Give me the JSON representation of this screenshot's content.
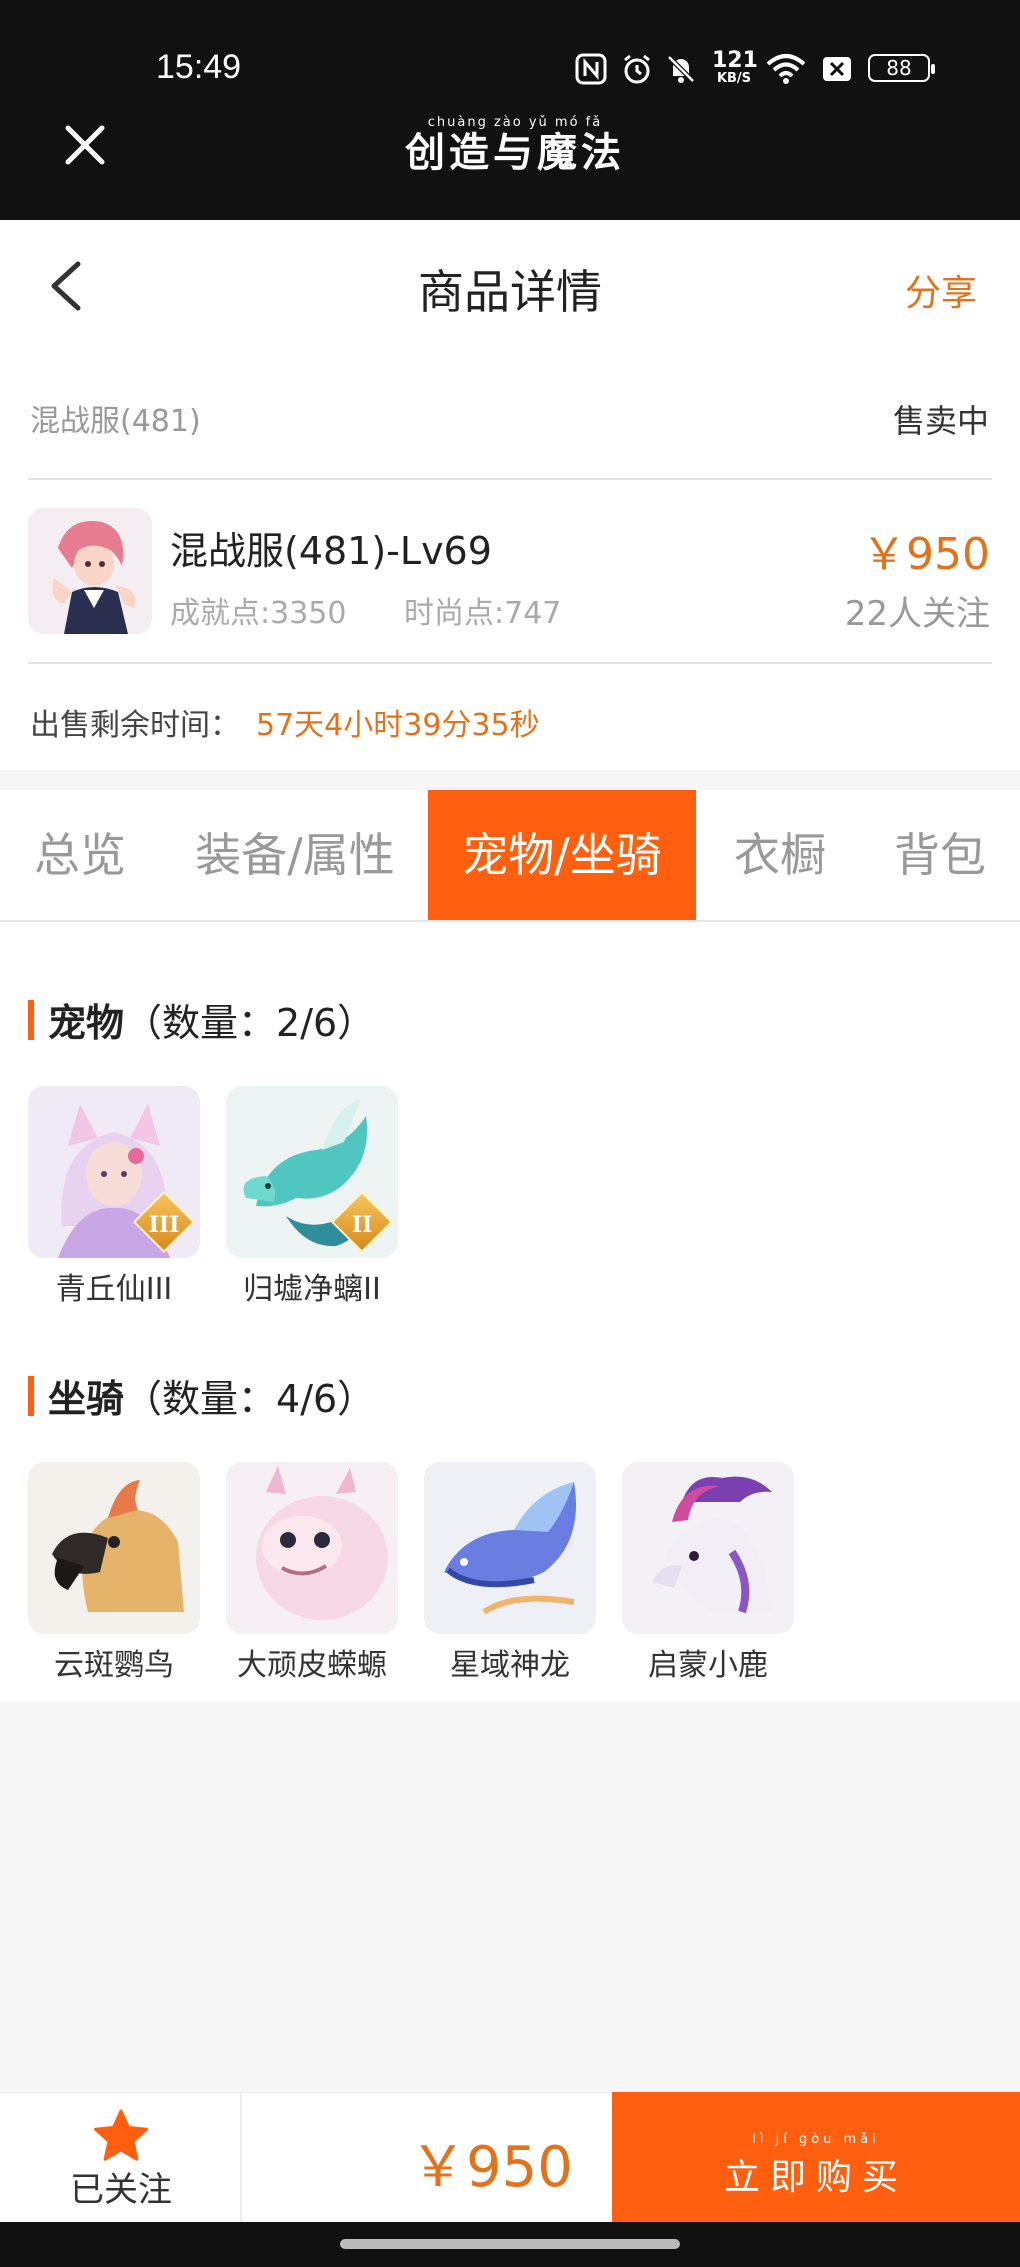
{
  "status_bar": {
    "time": "15:49",
    "net_speed_value": "121",
    "net_speed_unit": "KB/S",
    "battery": "88"
  },
  "app_header": {
    "brand_pinyin": "chuàng zào yǔ mó fǎ",
    "brand": "创造与魔法"
  },
  "nav": {
    "title": "商品详情",
    "share": "分享"
  },
  "listing": {
    "server": "混战服(481)",
    "status": "售卖中",
    "character_name": "混战服(481)-Lv69",
    "achievement": "成就点:3350",
    "fashion": "时尚点:747",
    "price": "￥950",
    "watchers": "22人关注",
    "remaining_label": "出售剩余时间：",
    "remaining_value": "57天4小时39分35秒"
  },
  "tabs": [
    {
      "label": "总览",
      "active": false
    },
    {
      "label": "装备/属性",
      "active": false
    },
    {
      "label": "宠物/坐骑",
      "active": true
    },
    {
      "label": "衣橱",
      "active": false
    },
    {
      "label": "背包",
      "active": false
    }
  ],
  "pets": {
    "title": "宠物",
    "count": "（数量：2/6）",
    "items": [
      {
        "name": "青丘仙III",
        "rank": "III"
      },
      {
        "name": "归墟净螭II",
        "rank": "II"
      }
    ]
  },
  "mounts": {
    "title": "坐骑",
    "count": "（数量：4/6）",
    "items": [
      {
        "name": "云斑鹦鸟"
      },
      {
        "name": "大顽皮蝾螈"
      },
      {
        "name": "星域神龙"
      },
      {
        "name": "启蒙小鹿"
      }
    ]
  },
  "bottom_bar": {
    "follow_label": "已关注",
    "price": "￥950",
    "buy_pinyin": "lì jí gòu mǎi",
    "buy_label": "立即购买"
  },
  "colors": {
    "accent": "#ff5f0f",
    "price": "#e3731b"
  }
}
